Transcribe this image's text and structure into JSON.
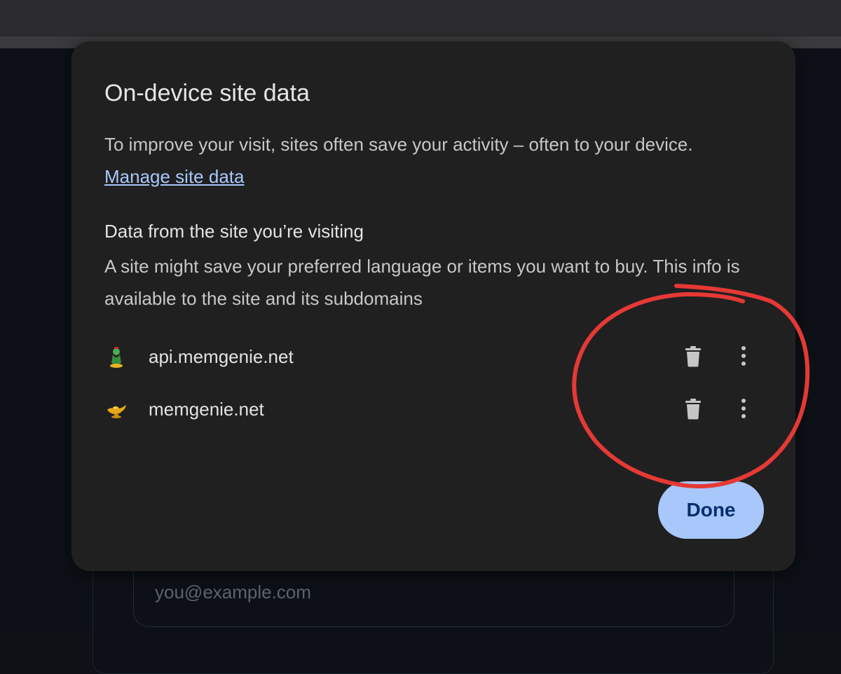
{
  "background": {
    "email_placeholder": "you@example.com"
  },
  "dialog": {
    "title": "On-device site data",
    "description": "To improve your visit, sites often save your activity – often to your device.",
    "manage_link": "Manage site data",
    "section_heading": "Data from the site you’re visiting",
    "section_description": "A site might save your preferred language or items you want to buy. This info is available to the site and its subdomains",
    "sites": [
      {
        "name": "api.memgenie.net",
        "favicon": "genie-icon"
      },
      {
        "name": "memgenie.net",
        "favicon": "magic-lamp-icon"
      }
    ],
    "done_label": "Done"
  },
  "colors": {
    "dialog_bg": "#202021",
    "link": "#a8c7fa",
    "done_bg": "#a8c7fa",
    "done_text": "#062e6f",
    "annotation": "#e53935"
  }
}
